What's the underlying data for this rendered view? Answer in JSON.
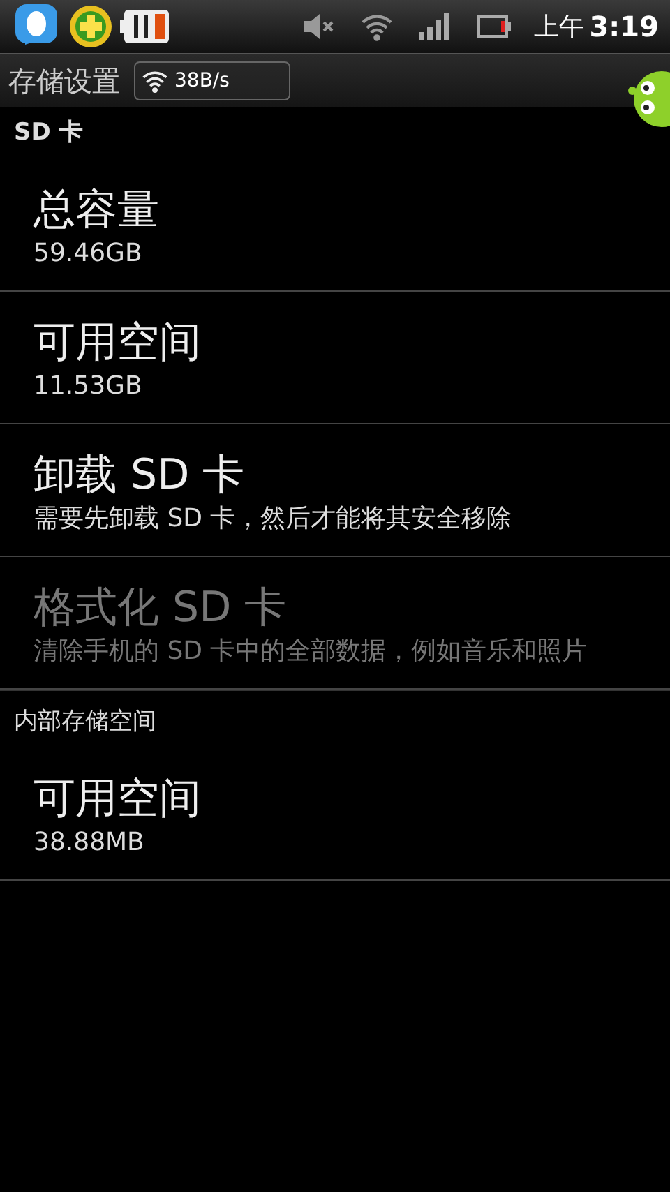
{
  "status_bar": {
    "period": "上午",
    "time": "3:19"
  },
  "overlay": {
    "speed": "38B/s"
  },
  "title": "存储设置",
  "sections": [
    {
      "header": "SD 卡",
      "items": [
        {
          "title": "总容量",
          "summary": "59.46GB",
          "disabled": false
        },
        {
          "title": "可用空间",
          "summary": "11.53GB",
          "disabled": false
        },
        {
          "title": "卸载 SD 卡",
          "summary": "需要先卸载 SD 卡，然后才能将其安全移除",
          "disabled": false
        },
        {
          "title": "格式化 SD 卡",
          "summary": "清除手机的 SD 卡中的全部数据，例如音乐和照片",
          "disabled": true
        }
      ]
    },
    {
      "header": "内部存储空间",
      "items": [
        {
          "title": "可用空间",
          "summary": "38.88MB",
          "disabled": false
        }
      ]
    }
  ]
}
